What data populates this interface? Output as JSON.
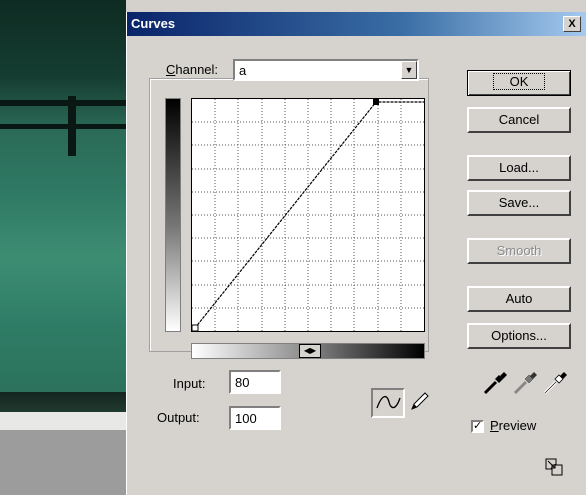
{
  "dialog": {
    "title": "Curves",
    "close_glyph": "X"
  },
  "channel": {
    "label_prefix": "C",
    "label_rest": "hannel:",
    "value": "a"
  },
  "input": {
    "label": "Input:",
    "value": "80"
  },
  "output": {
    "label": "Output:",
    "value": "100"
  },
  "buttons": {
    "ok": "OK",
    "cancel": "Cancel",
    "load": "Load...",
    "save": "Save...",
    "smooth": "Smooth",
    "auto": "Auto",
    "options": "Options..."
  },
  "preview": {
    "label": "Preview",
    "checked": true
  },
  "icons": {
    "curve_tool": "curve-tool-icon",
    "pencil_tool": "pencil-icon",
    "black_eyedropper": "black-eyedropper-icon",
    "gray_eyedropper": "gray-eyedropper-icon",
    "white_eyedropper": "white-eyedropper-icon"
  },
  "colors": {
    "title_gradient_start": "#0a246a",
    "title_gradient_end": "#a6caf0",
    "dialog_bg": "#d6d3ce"
  }
}
